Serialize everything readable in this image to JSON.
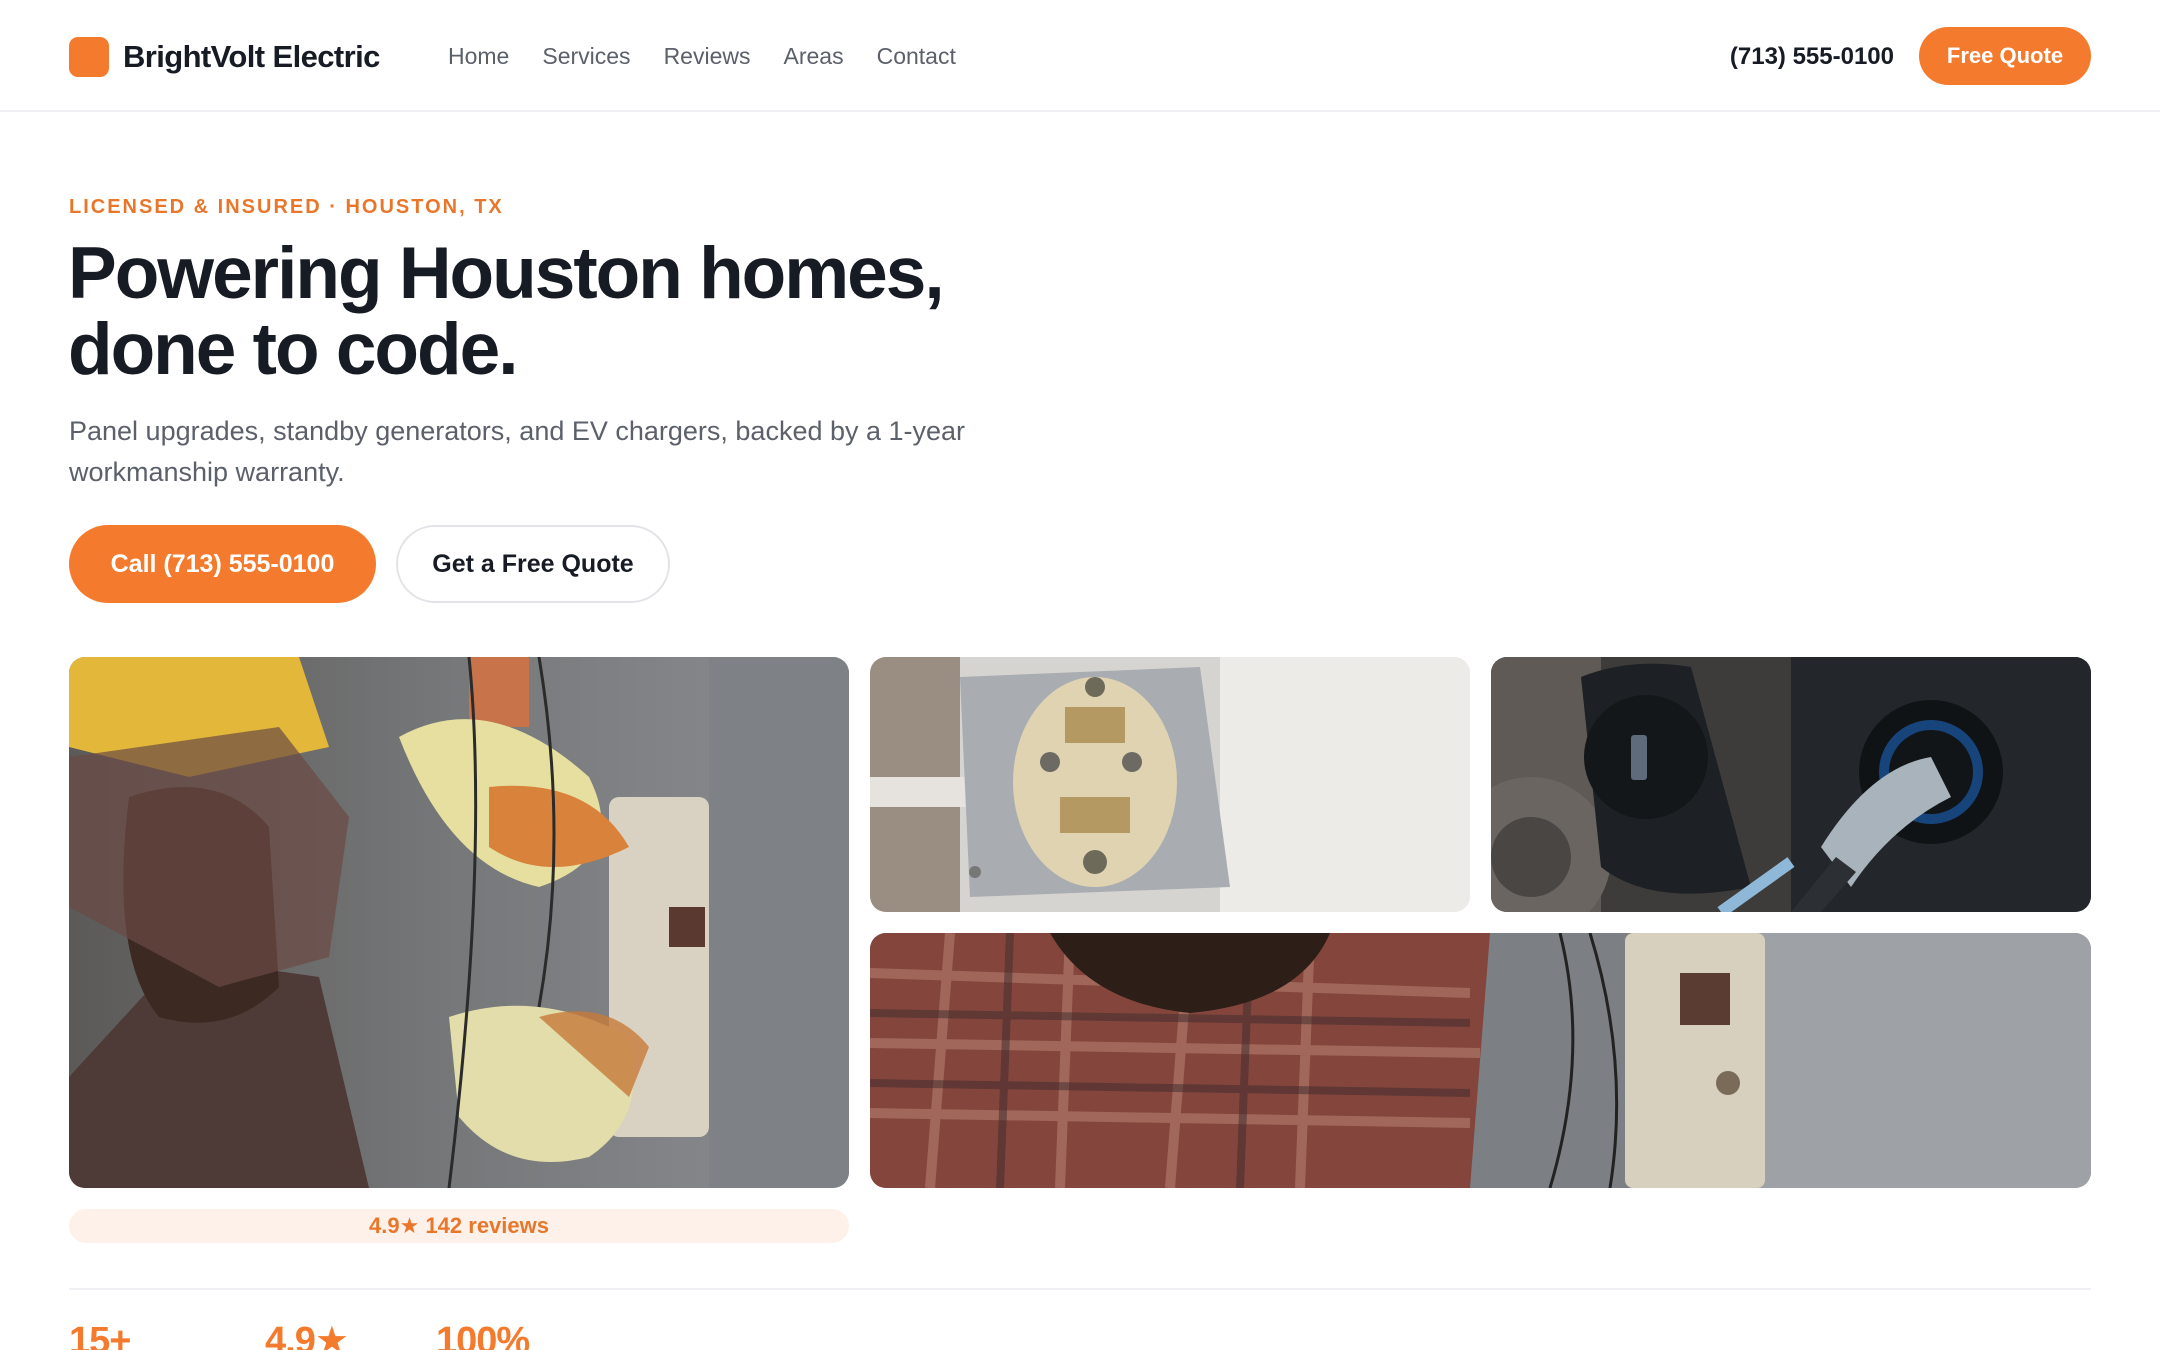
{
  "brand": {
    "name": "BrightVolt Electric",
    "accent_color": "#f47b2d"
  },
  "nav": {
    "items": [
      "Home",
      "Services",
      "Reviews",
      "Areas",
      "Contact"
    ]
  },
  "header": {
    "phone": "(713) 555-0100",
    "cta_label": "Free Quote"
  },
  "hero": {
    "eyebrow": "LICENSED & INSURED · HOUSTON, TX",
    "headline_line1": "Powering Houston homes,",
    "headline_line2": "done to code.",
    "subhead": "Panel upgrades, standby generators, and EV chargers, backed by a 1-year workmanship warranty.",
    "primary_cta": "Call (713) 555-0100",
    "secondary_cta": "Get a Free Quote"
  },
  "gallery": {
    "photos": [
      "electrician-working-on-panel-photo",
      "wall-outlet-wiring-photo",
      "ev-charger-plug-photo",
      "electrician-closeup-panel-photo"
    ]
  },
  "rating_badge": {
    "text": "4.9★ 142 reviews"
  },
  "stats": {
    "items": [
      "15+",
      "4.9★",
      "100%"
    ]
  }
}
